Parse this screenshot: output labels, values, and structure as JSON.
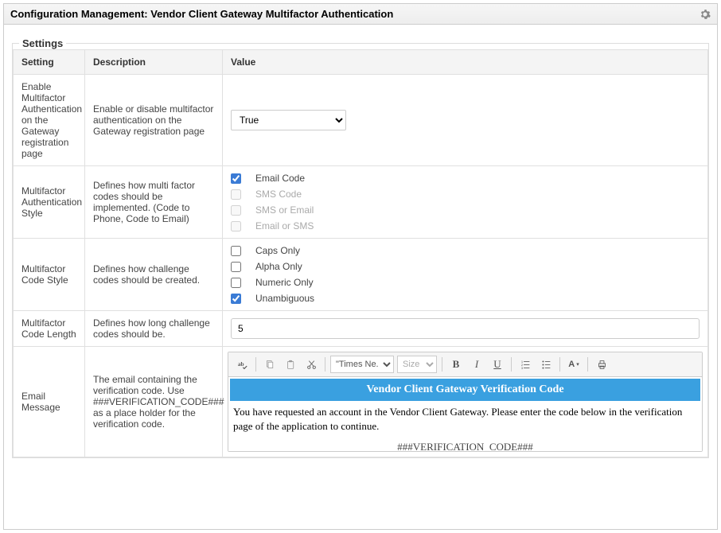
{
  "header": {
    "title": "Configuration Management: Vendor Client Gateway Multifactor Authentication"
  },
  "fieldset_label": "Settings",
  "columns": {
    "setting": "Setting",
    "description": "Description",
    "value": "Value"
  },
  "rows": {
    "enable_mfa": {
      "setting": "Enable Multifactor Authentication on the Gateway registration page",
      "description": "Enable or disable multifactor authentication on the Gateway registration page",
      "value_selected": "True"
    },
    "mfa_style": {
      "setting": "Multifactor Authentication Style",
      "description": "Defines how multi factor codes should be implemented. (Code to Phone, Code to Email)",
      "options": {
        "email_code": "Email Code",
        "sms_code": "SMS Code",
        "sms_or_email": "SMS or Email",
        "email_or_sms": "Email or SMS"
      }
    },
    "code_style": {
      "setting": "Multifactor Code Style",
      "description": "Defines how challenge codes should be created.",
      "options": {
        "caps": "Caps Only",
        "alpha": "Alpha Only",
        "numeric": "Numeric Only",
        "unambiguous": "Unambiguous"
      }
    },
    "code_length": {
      "setting": "Multifactor Code Length",
      "description": "Defines how long challenge codes should be.",
      "value": "5"
    },
    "email_message": {
      "setting": "Email Message",
      "description": "The email containing the verification code. Use ###VERIFICATION_CODE### as a place holder for the verification code.",
      "toolbar": {
        "font_name": "\"Times Ne...",
        "size_placeholder": "Size"
      },
      "content": {
        "banner": "Vendor Client Gateway Verification Code",
        "body": "You have requested an account in the Vendor Client Gateway. Please enter the code below in the verification page of the application to continue.",
        "placeholder": "###VERIFICATION_CODE###"
      }
    }
  }
}
